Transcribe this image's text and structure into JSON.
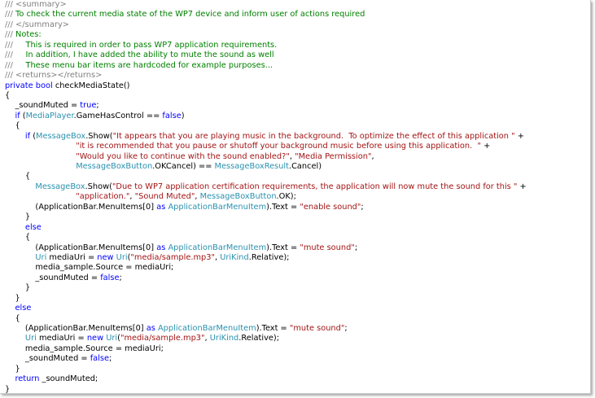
{
  "colors": {
    "keyword": "#0000ff",
    "comment": "#008000",
    "doc_tag": "#808080",
    "type": "#2b91af",
    "string": "#a31515",
    "plain": "#000000",
    "background": "#ffffff"
  },
  "code_lines": [
    [
      [
        "dc",
        "/// "
      ],
      [
        "dc",
        "<summary>"
      ]
    ],
    [
      [
        "dc",
        "/// "
      ],
      [
        "cm",
        "To check the current media state of the WP7 device and inform user of actions required"
      ]
    ],
    [
      [
        "dc",
        "/// "
      ],
      [
        "dc",
        "</summary>"
      ]
    ],
    [
      [
        "dc",
        "/// "
      ],
      [
        "cm",
        "Notes:"
      ]
    ],
    [
      [
        "dc",
        "/// "
      ],
      [
        "cm",
        "    This is required in order to pass WP7 application requirements."
      ]
    ],
    [
      [
        "dc",
        "/// "
      ],
      [
        "cm",
        "    In addition, I have added the ability to mute the sound as well"
      ]
    ],
    [
      [
        "dc",
        "/// "
      ],
      [
        "cm",
        "    These menu bar items are hardcoded for example purposes..."
      ]
    ],
    [
      [
        "dc",
        "/// "
      ],
      [
        "dc",
        "<returns></returns>"
      ]
    ],
    [
      [
        "kw",
        "private"
      ],
      [
        "pl",
        " "
      ],
      [
        "kw",
        "bool"
      ],
      [
        "pl",
        " checkMediaState()"
      ]
    ],
    [
      [
        "pl",
        "{"
      ]
    ],
    [
      [
        "pl",
        "    _soundMuted = "
      ],
      [
        "kw",
        "true"
      ],
      [
        "pl",
        ";"
      ]
    ],
    [
      [
        "pl",
        "    "
      ],
      [
        "kw",
        "if"
      ],
      [
        "pl",
        " ("
      ],
      [
        "ty",
        "MediaPlayer"
      ],
      [
        "pl",
        ".GameHasControl == "
      ],
      [
        "kw",
        "false"
      ],
      [
        "pl",
        ")"
      ]
    ],
    [
      [
        "pl",
        "    {"
      ]
    ],
    [
      [
        "pl",
        "        "
      ],
      [
        "kw",
        "if"
      ],
      [
        "pl",
        " ("
      ],
      [
        "ty",
        "MessageBox"
      ],
      [
        "pl",
        ".Show("
      ],
      [
        "st",
        "\"It appears that you are playing music in the background.  To optimize the effect of this application \""
      ],
      [
        "pl",
        " +"
      ]
    ],
    [
      [
        "pl",
        "                            "
      ],
      [
        "st",
        "\"it is recommended that you pause or shutoff your background music before using this application.  \""
      ],
      [
        "pl",
        " +"
      ]
    ],
    [
      [
        "pl",
        "                            "
      ],
      [
        "st",
        "\"Would you like to continue with the sound enabled?\""
      ],
      [
        "pl",
        ", "
      ],
      [
        "st",
        "\"Media Permission\""
      ],
      [
        "pl",
        ","
      ]
    ],
    [
      [
        "pl",
        "                            "
      ],
      [
        "ty",
        "MessageBoxButton"
      ],
      [
        "pl",
        ".OKCancel) == "
      ],
      [
        "ty",
        "MessageBoxResult"
      ],
      [
        "pl",
        ".Cancel)"
      ]
    ],
    [
      [
        "pl",
        "        {"
      ]
    ],
    [
      [
        "pl",
        "            "
      ],
      [
        "ty",
        "MessageBox"
      ],
      [
        "pl",
        ".Show("
      ],
      [
        "st",
        "\"Due to WP7 application certification requirements, the application will now mute the sound for this \""
      ],
      [
        "pl",
        " +"
      ]
    ],
    [
      [
        "pl",
        "                            "
      ],
      [
        "st",
        "\"application.\""
      ],
      [
        "pl",
        ", "
      ],
      [
        "st",
        "\"Sound Muted\""
      ],
      [
        "pl",
        ", "
      ],
      [
        "ty",
        "MessageBoxButton"
      ],
      [
        "pl",
        ".OK);"
      ]
    ],
    [
      [
        "pl",
        "            (ApplicationBar.MenuItems[0] "
      ],
      [
        "kw",
        "as"
      ],
      [
        "pl",
        " "
      ],
      [
        "ty",
        "ApplicationBarMenuItem"
      ],
      [
        "pl",
        ").Text = "
      ],
      [
        "st",
        "\"enable sound\""
      ],
      [
        "pl",
        ";"
      ]
    ],
    [
      [
        "pl",
        "        }"
      ]
    ],
    [
      [
        "pl",
        "        "
      ],
      [
        "kw",
        "else"
      ]
    ],
    [
      [
        "pl",
        "        {"
      ]
    ],
    [
      [
        "pl",
        "            (ApplicationBar.MenuItems[0] "
      ],
      [
        "kw",
        "as"
      ],
      [
        "pl",
        " "
      ],
      [
        "ty",
        "ApplicationBarMenuItem"
      ],
      [
        "pl",
        ").Text = "
      ],
      [
        "st",
        "\"mute sound\""
      ],
      [
        "pl",
        ";"
      ]
    ],
    [
      [
        "pl",
        "            "
      ],
      [
        "ty",
        "Uri"
      ],
      [
        "pl",
        " mediaUri = "
      ],
      [
        "kw",
        "new"
      ],
      [
        "pl",
        " "
      ],
      [
        "ty",
        "Uri"
      ],
      [
        "pl",
        "("
      ],
      [
        "st",
        "\"media/sample.mp3\""
      ],
      [
        "pl",
        ", "
      ],
      [
        "ty",
        "UriKind"
      ],
      [
        "pl",
        ".Relative);"
      ]
    ],
    [
      [
        "pl",
        "            media_sample.Source = mediaUri;"
      ]
    ],
    [
      [
        "pl",
        "            _soundMuted = "
      ],
      [
        "kw",
        "false"
      ],
      [
        "pl",
        ";"
      ]
    ],
    [
      [
        "pl",
        "        }"
      ]
    ],
    [
      [
        "pl",
        "    }"
      ]
    ],
    [
      [
        "pl",
        "    "
      ],
      [
        "kw",
        "else"
      ]
    ],
    [
      [
        "pl",
        "    {"
      ]
    ],
    [
      [
        "pl",
        "        (ApplicationBar.MenuItems[0] "
      ],
      [
        "kw",
        "as"
      ],
      [
        "pl",
        " "
      ],
      [
        "ty",
        "ApplicationBarMenuItem"
      ],
      [
        "pl",
        ").Text = "
      ],
      [
        "st",
        "\"mute sound\""
      ],
      [
        "pl",
        ";"
      ]
    ],
    [
      [
        "pl",
        "        "
      ],
      [
        "ty",
        "Uri"
      ],
      [
        "pl",
        " mediaUri = "
      ],
      [
        "kw",
        "new"
      ],
      [
        "pl",
        " "
      ],
      [
        "ty",
        "Uri"
      ],
      [
        "pl",
        "("
      ],
      [
        "st",
        "\"media/sample.mp3\""
      ],
      [
        "pl",
        ", "
      ],
      [
        "ty",
        "UriKind"
      ],
      [
        "pl",
        ".Relative);"
      ]
    ],
    [
      [
        "pl",
        "        media_sample.Source = mediaUri;"
      ]
    ],
    [
      [
        "pl",
        "        _soundMuted = "
      ],
      [
        "kw",
        "false"
      ],
      [
        "pl",
        ";"
      ]
    ],
    [
      [
        "pl",
        "    }"
      ]
    ],
    [
      [
        "pl",
        "    "
      ],
      [
        "kw",
        "return"
      ],
      [
        "pl",
        " _soundMuted;"
      ]
    ],
    [
      [
        "pl",
        "}"
      ]
    ]
  ]
}
